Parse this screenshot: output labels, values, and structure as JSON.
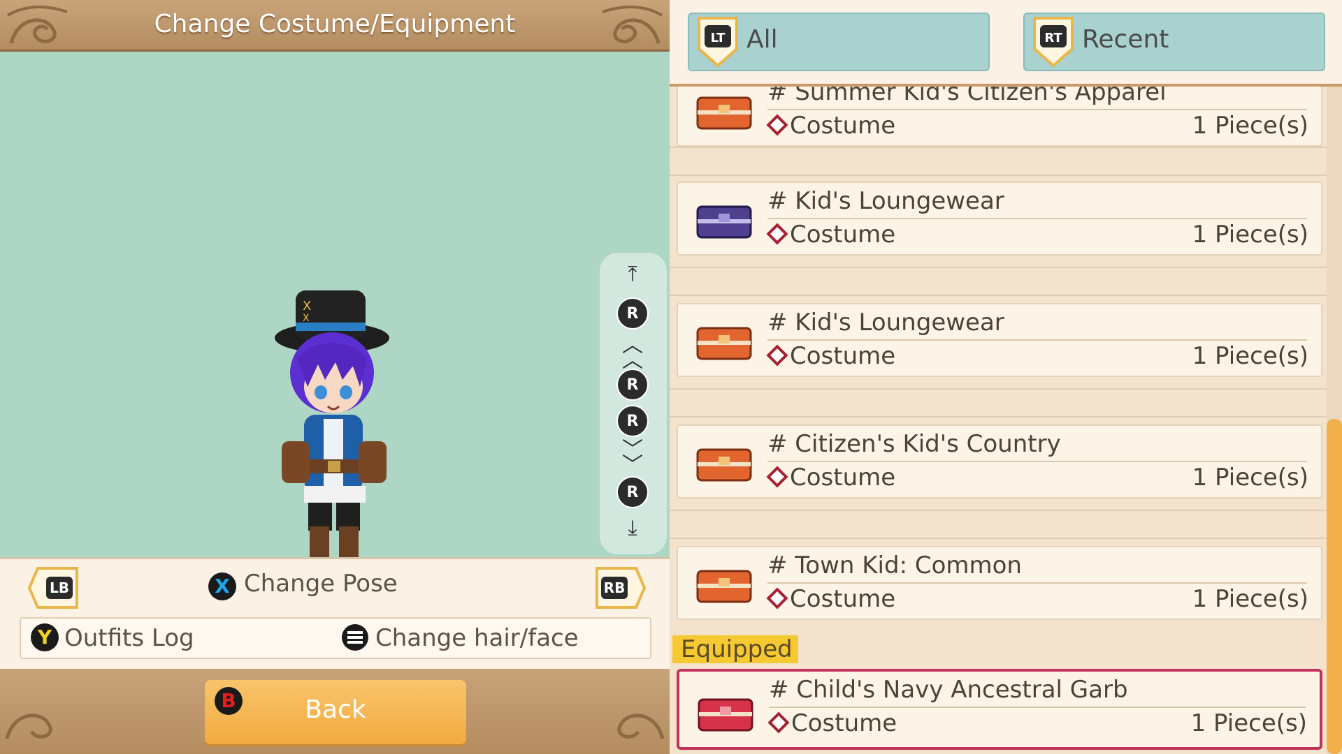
{
  "header": {
    "title": "Change Costume/Equipment"
  },
  "preview": {
    "character": "chibi character in navy outfit with black hat"
  },
  "controls": {
    "lb": "LB",
    "rb": "RB",
    "x_button": "X",
    "change_pose": "Change Pose",
    "y_button": "Y",
    "outfits_log": "Outfits Log",
    "change_hair_face": "Change hair/face",
    "b_button": "B",
    "back": "Back"
  },
  "camera": {
    "r": "R"
  },
  "tabs": [
    {
      "button": "LT",
      "label": "All"
    },
    {
      "button": "RT",
      "label": "Recent"
    }
  ],
  "items": [
    {
      "name": "# Summer Kid's Citizen's Apparel",
      "category": "Costume",
      "quantity": "1 Piece(s)",
      "box_color": "orange"
    },
    {
      "name": "# Kid's Loungewear",
      "category": "Costume",
      "quantity": "1 Piece(s)",
      "box_color": "purple"
    },
    {
      "name": "# Kid's Loungewear",
      "category": "Costume",
      "quantity": "1 Piece(s)",
      "box_color": "orange"
    },
    {
      "name": "# Citizen's Kid's Country",
      "category": "Costume",
      "quantity": "1 Piece(s)",
      "box_color": "orange"
    },
    {
      "name": "# Town Kid: Common",
      "category": "Costume",
      "quantity": "1 Piece(s)",
      "box_color": "orange"
    }
  ],
  "equipped": {
    "tag": "Equipped",
    "item": {
      "name": "# Child's Navy Ancestral Garb",
      "category": "Costume",
      "quantity": "1 Piece(s)",
      "box_color": "red"
    }
  },
  "colors": {
    "accent": "#f2aa3f",
    "tab": "#a9d1cf",
    "preview_bg": "#aed6c5",
    "equipped_border": "#c0345a"
  }
}
